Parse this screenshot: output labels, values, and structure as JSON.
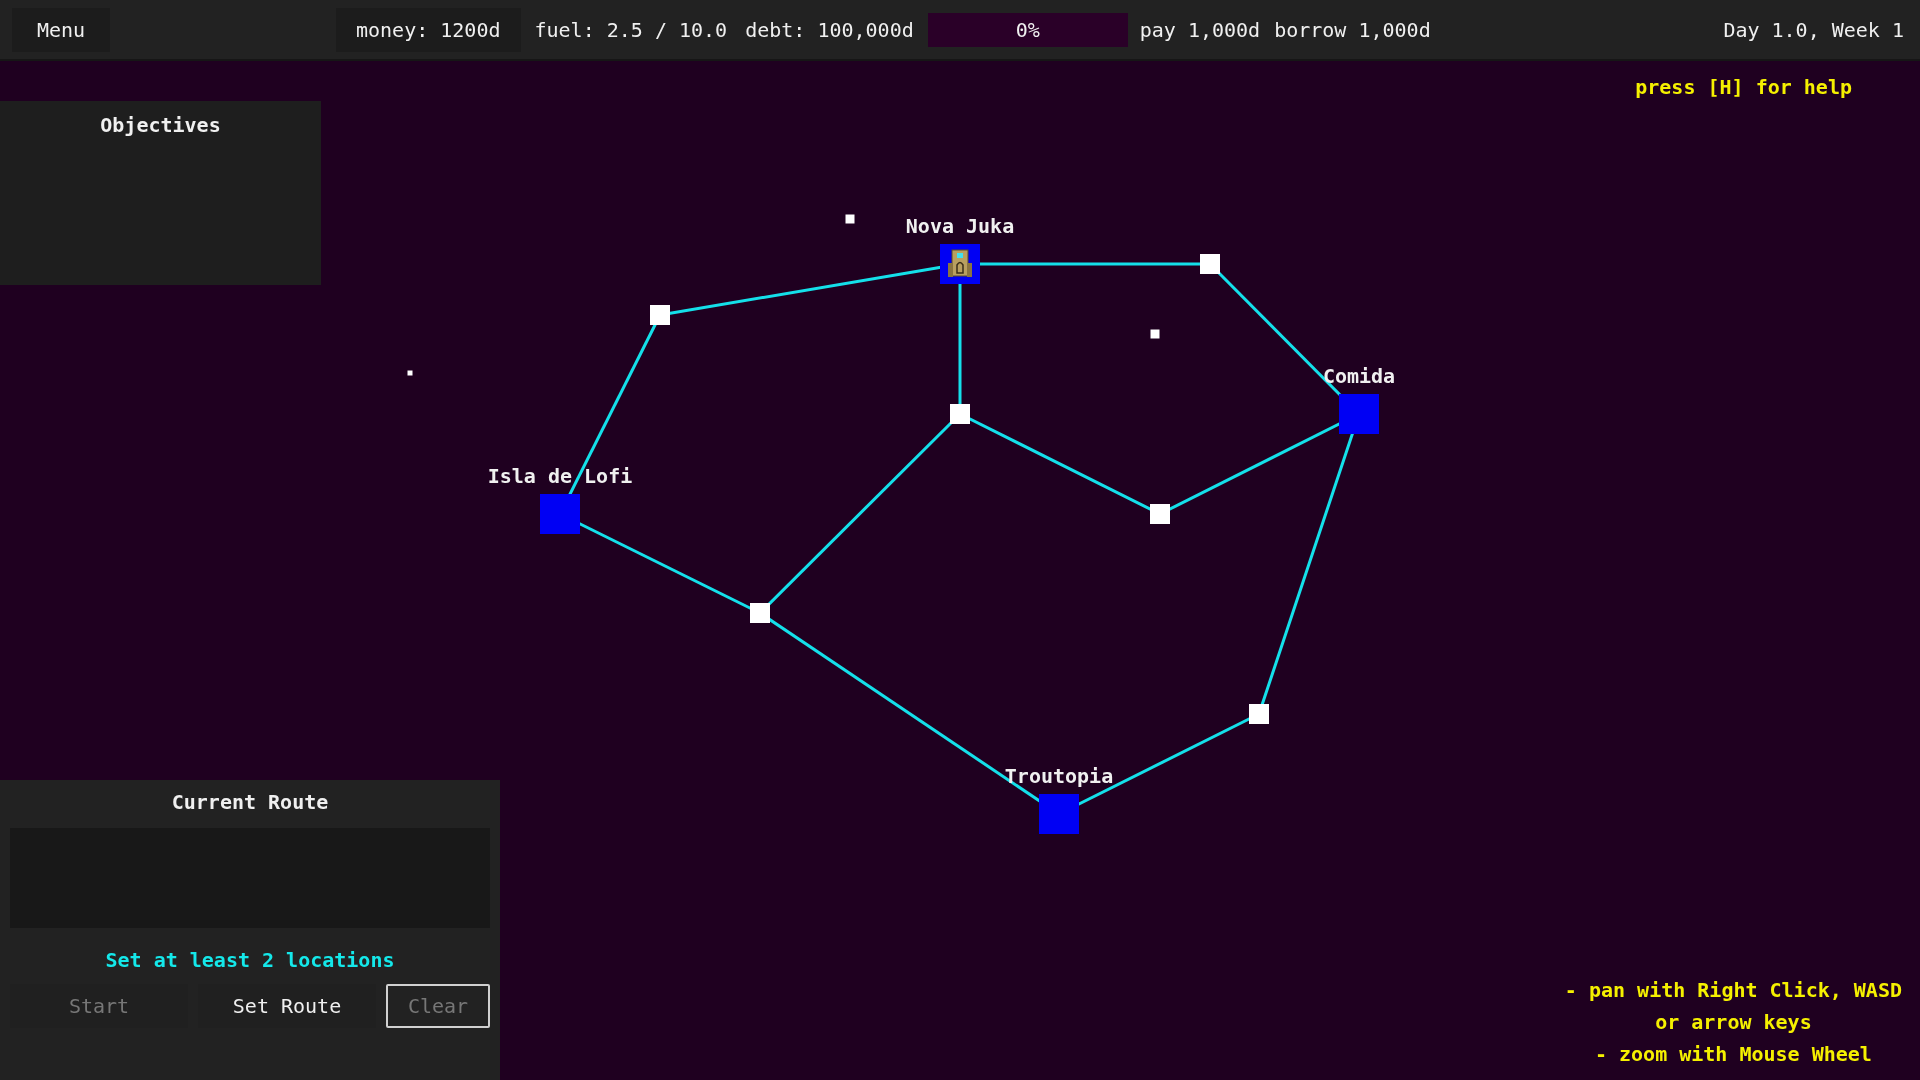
{
  "top_bar": {
    "menu": "Menu",
    "money": "money: 1200d",
    "fuel": "fuel: 2.5 / 10.0",
    "debt": "debt: 100,000d",
    "debt_progress": {
      "label": "0%",
      "level": 0
    },
    "pay": "pay 1,000d",
    "borrow": "borrow 1,000d",
    "date": "Day 1.0, Week 1"
  },
  "help_hint": "press [H] for help",
  "objectives": {
    "title": "Objectives"
  },
  "map": {
    "nodes": [
      {
        "kind": "city",
        "name": "Nova Juka",
        "ship": true
      },
      {
        "kind": "waypoint"
      },
      {
        "kind": "waypoint"
      },
      {
        "kind": "city",
        "name": "Comida",
        "ship": false
      },
      {
        "kind": "waypoint"
      },
      {
        "kind": "city",
        "name": "Isla de Lofi",
        "ship": false
      },
      {
        "kind": "waypoint"
      },
      {
        "kind": "waypoint"
      },
      {
        "kind": "waypoint"
      },
      {
        "kind": "city",
        "name": "Troutopia",
        "ship": false
      }
    ]
  },
  "current_route": {
    "title": "Current Route",
    "message": "Set at least 2 locations",
    "buttons": [
      {
        "label": "Start",
        "kind": "plain",
        "disabled": true
      },
      {
        "label": "Set Route",
        "kind": "plain",
        "disabled": false
      },
      {
        "label": "Clear",
        "kind": "outlined",
        "disabled": true
      }
    ]
  },
  "controls_hint": [
    "- pan with Right Click, WASD",
    "or arrow keys",
    "- zoom with Mouse Wheel"
  ]
}
